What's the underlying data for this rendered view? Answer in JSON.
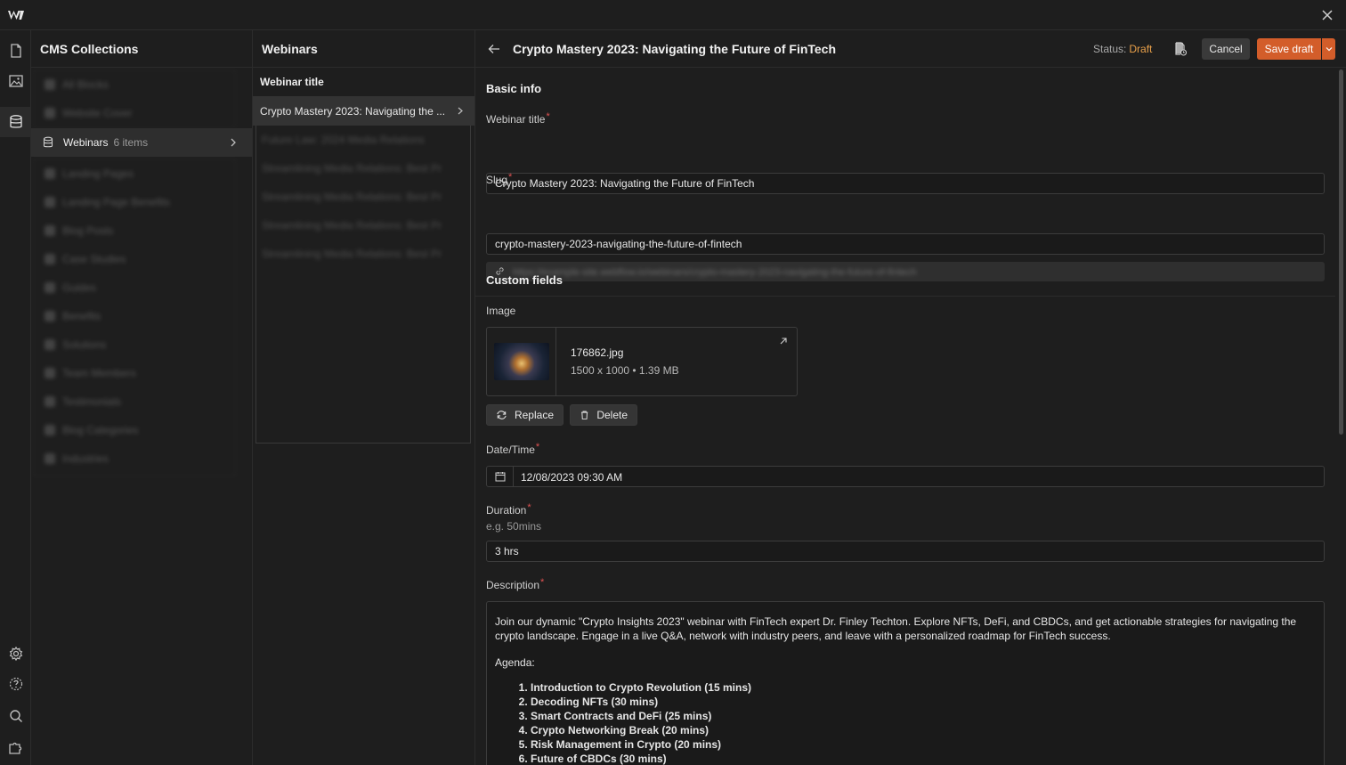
{
  "cms": {
    "title": "CMS Collections",
    "active_collection": {
      "name": "Webinars",
      "count": "6 items"
    },
    "blurred_top": [
      "All Blocks",
      "Website Cover"
    ],
    "blurred_bottom": [
      "Landing Pages",
      "Landing Page Benefits",
      "Blog Posts",
      "Case Studies",
      "Guides",
      "Benefits",
      "Solutions",
      "Team Members",
      "Testimonials",
      "Blog Categories",
      "Industries"
    ]
  },
  "list": {
    "title": "Webinars",
    "column_header": "Webinar title",
    "active_item": "Crypto Mastery 2023: Navigating the ...",
    "blurred_items": [
      "Future Law: 2024 Media Relations",
      "Streamlining Media Relations: Best Pr",
      "Streamlining Media Relations: Best Pr",
      "Streamlining Media Relations: Best Pr",
      "Streamlining Media Relations: Best Pr"
    ]
  },
  "editor": {
    "title": "Crypto Mastery 2023: Navigating the Future of FinTech",
    "status_label": "Status:",
    "status_value": "Draft",
    "cancel_label": "Cancel",
    "save_label": "Save draft",
    "basic_info_title": "Basic info",
    "webinar_title_label": "Webinar title",
    "webinar_title_value": "Crypto Mastery 2023: Navigating the Future of FinTech",
    "slug_label": "Slug",
    "slug_value": "crypto-mastery-2023-navigating-the-future-of-fintech",
    "slug_url_blurred": "https://example-site.webflow.io/webinars/crypto-mastery-2023-navigating-the-future-of-fintech",
    "custom_fields_title": "Custom fields",
    "image_label": "Image",
    "image_name": "176862.jpg",
    "image_meta": "1500 x 1000 • 1.39 MB",
    "replace_label": "Replace",
    "delete_label": "Delete",
    "datetime_label": "Date/Time",
    "datetime_value": "12/08/2023 09:30 AM",
    "duration_label": "Duration",
    "duration_hint": "e.g. 50mins",
    "duration_value": "3 hrs",
    "description_label": "Description",
    "description_intro": "Join our dynamic \"Crypto Insights 2023\" webinar with FinTech expert Dr. Finley Techton. Explore NFTs, DeFi, and CBDCs, and get actionable strategies for navigating the crypto landscape. Engage in a live Q&A, network with industry peers, and leave with a personalized roadmap for FinTech success.",
    "agenda_label": "Agenda:",
    "agenda": [
      "Introduction to Crypto Revolution (15 mins)",
      "Decoding NFTs (30 mins)",
      "Smart Contracts and DeFi (25 mins)",
      "Crypto Networking Break (20 mins)",
      "Risk Management in Crypto (20 mins)",
      "Future of CBDCs (30 mins)"
    ]
  },
  "colors": {
    "accent": "#d35d2a",
    "draft": "#e8a04a",
    "required": "#e05252",
    "bg": "#1e1e1e"
  }
}
